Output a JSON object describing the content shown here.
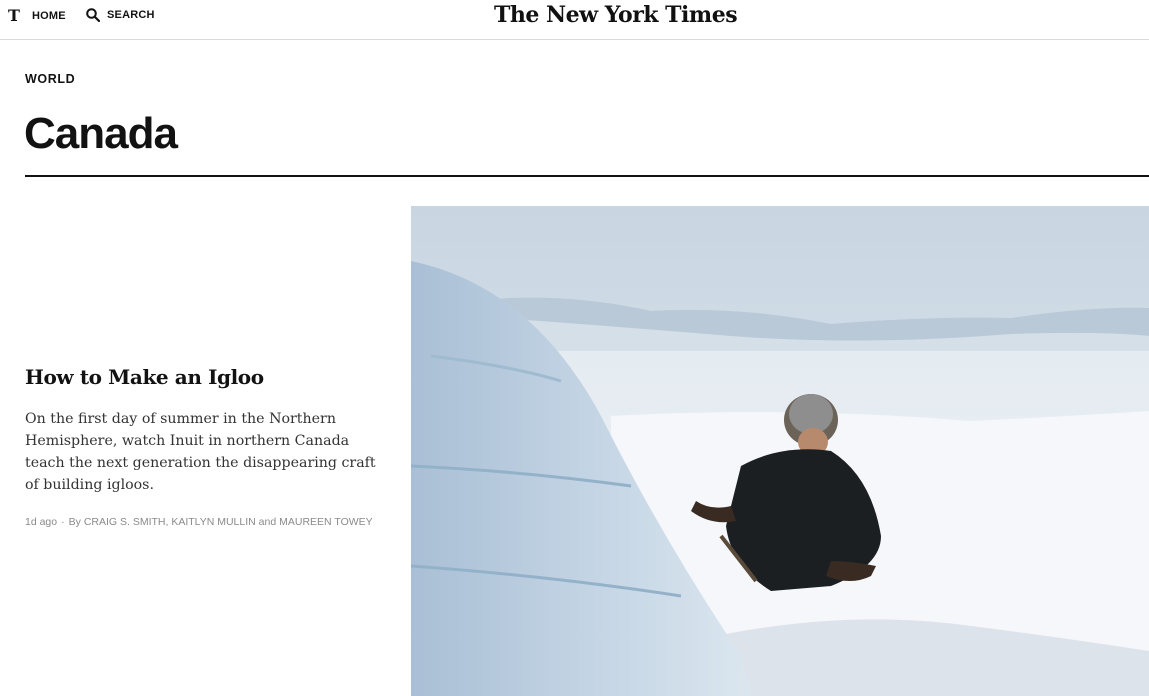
{
  "nav": {
    "home_label": "HOME",
    "search_label": "SEARCH",
    "masthead": "The New York Times",
    "logo_letter": "T"
  },
  "section": {
    "kicker": "WORLD",
    "title": "Canada"
  },
  "story": {
    "headline": "How to Make an Igloo",
    "summary": "On the first day of summer in the Northern Hemisphere, watch Inuit in northern Canada teach the next generation the disappearing craft of building igloos.",
    "timestamp": "1d ago",
    "byline_prefix": "By",
    "authors": "CRAIG S. SMITH, KAITLYN MULLIN",
    "and_word": "and",
    "last_author": "MAUREEN TOWEY"
  },
  "icons": {
    "search": "search-icon",
    "logo": "nyt-t-logo"
  }
}
